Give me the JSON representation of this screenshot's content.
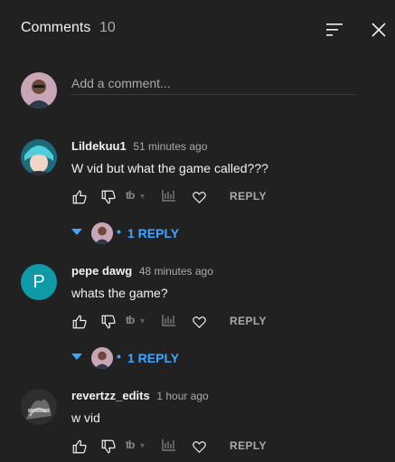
{
  "header": {
    "title": "Comments",
    "count": "10",
    "sort_icon": "sort-icon",
    "close_icon": "close-icon"
  },
  "add_comment": {
    "placeholder": "Add a comment..."
  },
  "comments": [
    {
      "author": "Lildekuu1",
      "time": "51 minutes ago",
      "text": "W vid but what the game called???",
      "reply_label": "REPLY",
      "replies_label": "1 REPLY",
      "avatar_color": "#3fb2c8"
    },
    {
      "author": "pepe dawg",
      "time": "48 minutes ago",
      "text": "whats the game?",
      "reply_label": "REPLY",
      "replies_label": "1 REPLY",
      "avatar_letter": "P",
      "avatar_color": "#0e9aa7"
    },
    {
      "author": "revertzz_edits",
      "time": "1 hour ago",
      "text": "w vid",
      "reply_label": "REPLY",
      "avatar_color": "#3b3b3b"
    }
  ],
  "colors": {
    "background": "#212121",
    "link_blue": "#3ea6ff",
    "muted": "#aaaaaa"
  }
}
